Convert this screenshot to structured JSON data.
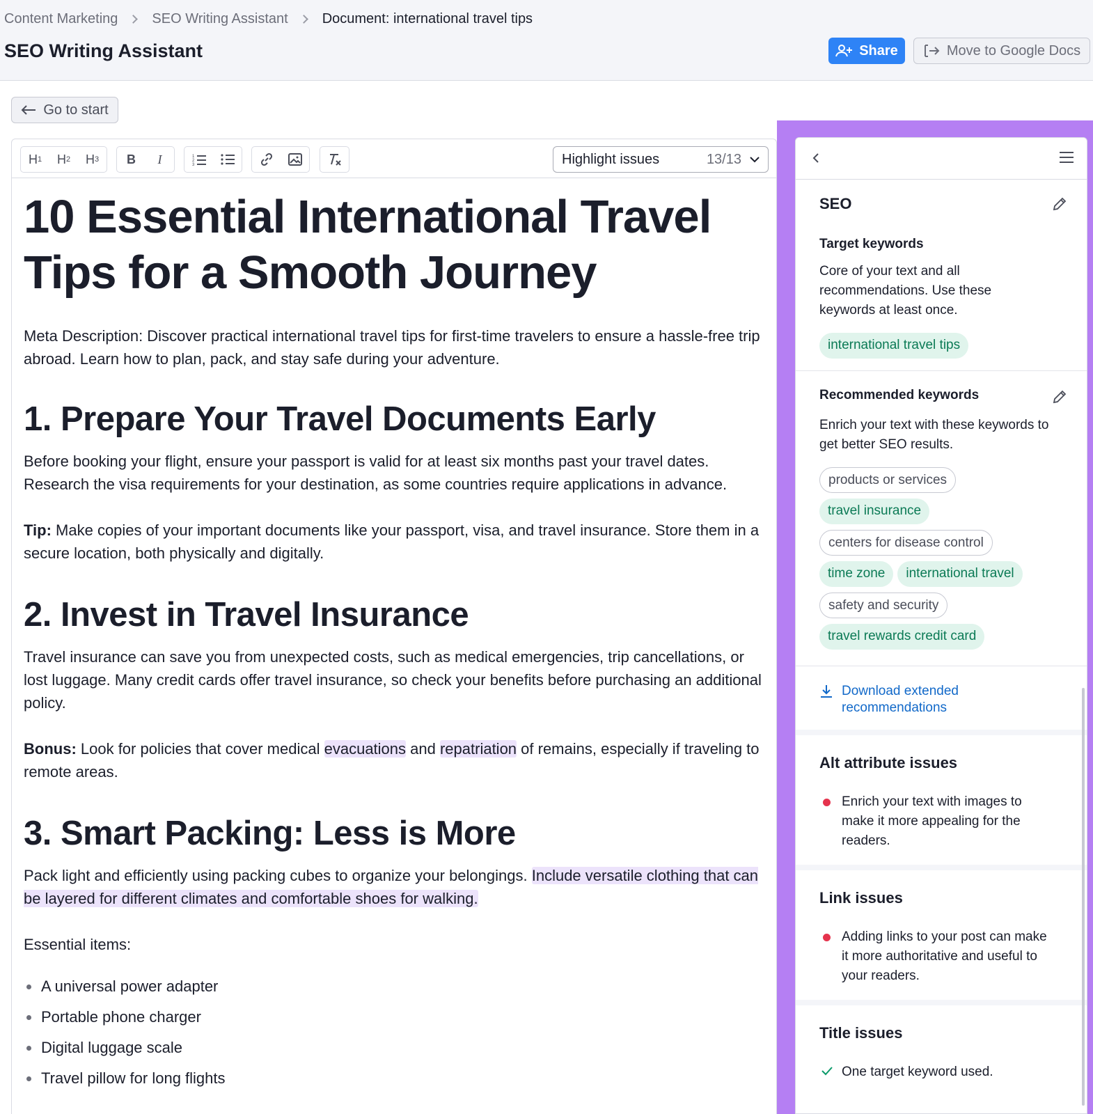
{
  "breadcrumb": [
    "Content Marketing",
    "SEO Writing Assistant",
    "Document: international travel tips"
  ],
  "page_title": "SEO Writing Assistant",
  "header": {
    "share_label": "Share",
    "gdocs_label": "Move to Google Docs"
  },
  "go_to_start": "Go to start",
  "toolbar": {
    "h1": "H",
    "h2": "H",
    "h3": "H",
    "h1_sub": "1",
    "h2_sub": "2",
    "h3_sub": "3",
    "bold": "B",
    "italic": "I",
    "highlight_label": "Highlight issues",
    "highlight_count": "13/13"
  },
  "doc": {
    "title": "10 Essential International Travel Tips for a Smooth Journey",
    "meta": "Meta Description: Discover practical international travel tips for first-time travelers to ensure a hassle-free trip abroad. Learn how to plan, pack, and stay safe during your adventure.",
    "s1_h": "1. Prepare Your Travel Documents Early",
    "s1_p": "Before booking your flight, ensure your passport is valid for at least six months past your travel dates. Research the visa requirements for your destination, as some countries require applications in advance.",
    "s1_tip_label": "Tip:",
    "s1_tip": " Make copies of your important documents like your passport, visa, and travel insurance. Store them in a secure location, both physically and digitally.",
    "s2_h": "2. Invest in Travel Insurance",
    "s2_p": "Travel insurance can save you from unexpected costs, such as medical emergencies, trip cancellations, or lost luggage. Many credit cards offer travel insurance, so check your benefits before purchasing an additional policy.",
    "s2_bonus_label": "Bonus:",
    "s2_bonus_a": " Look for policies that cover medical ",
    "s2_bonus_hl1": "evacuations",
    "s2_bonus_b": " and ",
    "s2_bonus_hl2": "repatriation",
    "s2_bonus_c": " of remains, especially if traveling to remote areas.",
    "s3_h": "3. Smart Packing: Less is More",
    "s3_p_a": "Pack light and efficiently using packing cubes to organize your belongings. ",
    "s3_p_hl": "Include versatile clothing that can be layered for different climates and comfortable shoes for walking.",
    "s3_items_label": "Essential items:",
    "s3_items": [
      "A universal power adapter",
      "Portable phone charger",
      "Digital luggage scale",
      "Travel pillow for long flights"
    ]
  },
  "sidebar": {
    "seo_title": "SEO",
    "target_title": "Target keywords",
    "target_desc": "Core of your text and all recommendations. Use these keywords at least once.",
    "target_keywords": [
      {
        "text": "international travel tips",
        "used": true
      }
    ],
    "rec_title": "Recommended keywords",
    "rec_desc": "Enrich your text with these keywords to get better SEO results.",
    "rec_keywords": [
      {
        "text": "products or services",
        "used": false
      },
      {
        "text": "travel insurance",
        "used": true
      },
      {
        "text": "centers for disease control",
        "used": false
      },
      {
        "text": "time zone",
        "used": true
      },
      {
        "text": "international travel",
        "used": true
      },
      {
        "text": "safety and security",
        "used": false
      },
      {
        "text": "travel rewards credit card",
        "used": true
      }
    ],
    "download_label": "Download extended recommendations",
    "alt_title": "Alt attribute issues",
    "alt_issue": "Enrich your text with images to make it more appealing for the readers.",
    "link_title": "Link issues",
    "link_issue": "Adding links to your post can make it more authoritative and useful to your readers.",
    "title_issues_title": "Title issues",
    "title_issue": "One target keyword used."
  },
  "colors": {
    "accent_blue": "#2e83f6",
    "highlight_purple": "#ece3fb",
    "frame_purple": "#b57ff3",
    "keyword_green_bg": "#e0f4ec",
    "keyword_green_text": "#0b7a55",
    "issue_red": "#e5334d"
  }
}
